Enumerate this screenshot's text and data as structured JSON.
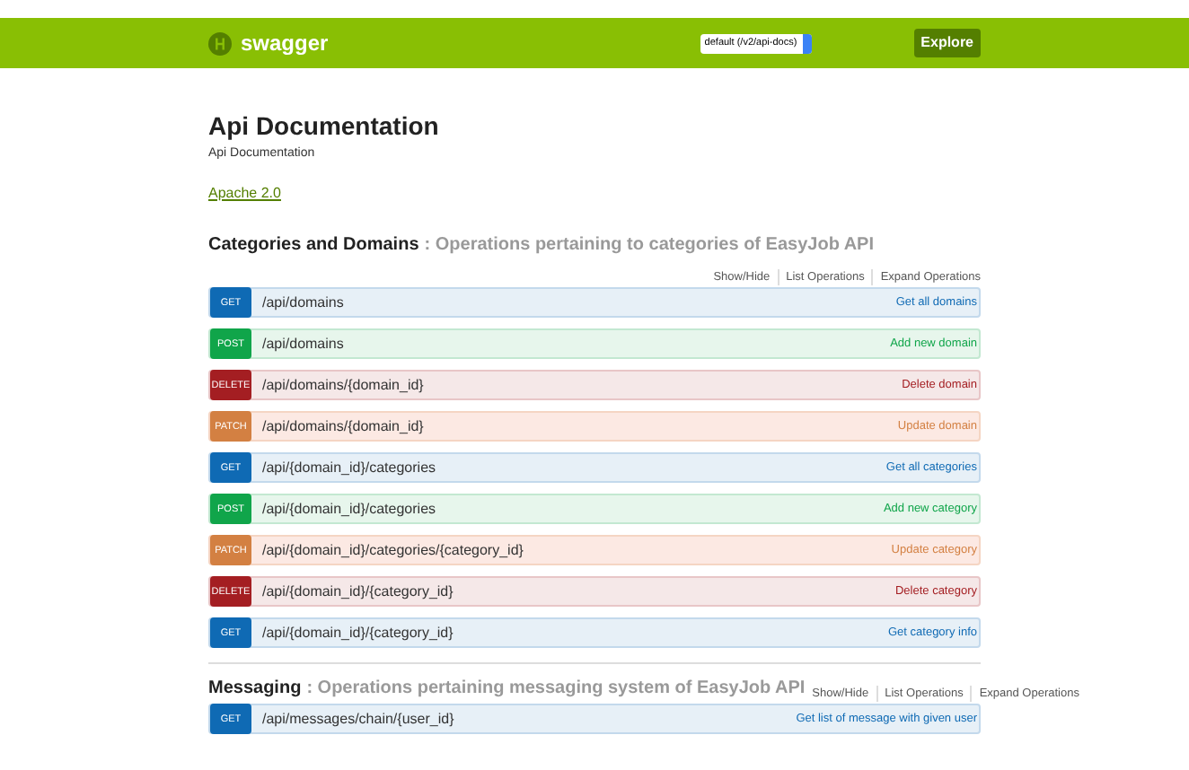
{
  "header": {
    "brand": "swagger",
    "spec_select": "default (/v2/api-docs)",
    "explore_button": "Explore"
  },
  "info": {
    "title": "Api Documentation",
    "description": "Api Documentation",
    "license": "Apache 2.0"
  },
  "sections": [
    {
      "name": "Categories and Domains",
      "description": ": Operations pertaining to categories of EasyJob API",
      "links": [
        "Show/Hide",
        "List Operations",
        "Expand Operations"
      ],
      "operations": [
        {
          "method": "GET",
          "path": "/api/domains",
          "summary": "Get all domains"
        },
        {
          "method": "POST",
          "path": "/api/domains",
          "summary": "Add new domain"
        },
        {
          "method": "DELETE",
          "path": "/api/domains/{domain_id}",
          "summary": "Delete domain"
        },
        {
          "method": "PATCH",
          "path": "/api/domains/{domain_id}",
          "summary": "Update domain"
        },
        {
          "method": "GET",
          "path": "/api/{domain_id}/categories",
          "summary": "Get all categories"
        },
        {
          "method": "POST",
          "path": "/api/{domain_id}/categories",
          "summary": "Add new category"
        },
        {
          "method": "PATCH",
          "path": "/api/{domain_id}/categories/{category_id}",
          "summary": "Update category"
        },
        {
          "method": "DELETE",
          "path": "/api/{domain_id}/{category_id}",
          "summary": "Delete category"
        },
        {
          "method": "GET",
          "path": "/api/{domain_id}/{category_id}",
          "summary": "Get category info"
        }
      ]
    },
    {
      "name": "Messaging",
      "description": ": Operations pertaining messaging system of EasyJob API",
      "links": [
        "Show/Hide",
        "List Operations",
        "Expand Operations"
      ],
      "operations": [
        {
          "method": "GET",
          "path": "/api/messages/chain/{user_id}",
          "summary": "Get list of message with given user"
        }
      ]
    }
  ]
}
